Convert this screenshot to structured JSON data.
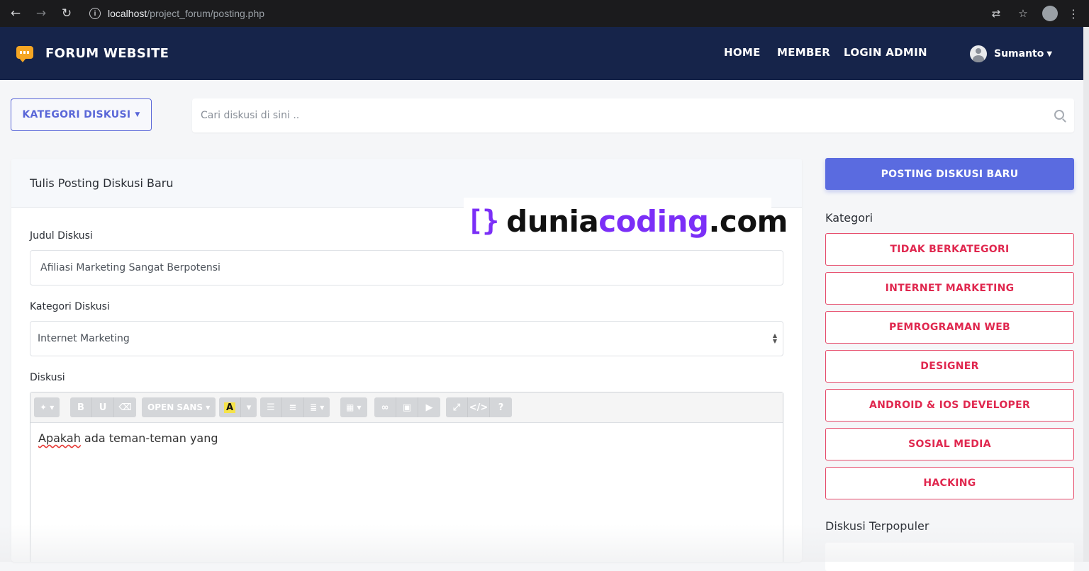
{
  "browser": {
    "url_host": "localhost",
    "url_path": "/project_forum/posting.php",
    "icons": [
      "back-arrow-icon",
      "forward-arrow-icon",
      "reload-icon",
      "info-icon",
      "translate-icon",
      "star-icon",
      "profile-icon",
      "more-icon"
    ]
  },
  "navbar": {
    "brand": "FORUM WEBSITE",
    "menu": [
      "HOME",
      "MEMBER",
      "LOGIN ADMIN"
    ],
    "user": "Sumanto",
    "bg_color": "#16244a"
  },
  "toolbar": {
    "kategori_button": "KATEGORI DISKUSI",
    "search_placeholder": "Cari diskusi di sini .."
  },
  "form": {
    "title": "Tulis Posting Diskusi Baru",
    "judul_label": "Judul Diskusi",
    "judul_value": "Afiliasi Marketing Sangat Berpotensi",
    "kategori_label": "Kategori Diskusi",
    "kategori_value": "Internet Marketing",
    "diskusi_label": "Diskusi",
    "editor_font": "OPEN SANS",
    "editor_text_spell": "Apakah",
    "editor_text_rest": " ada teman-teman yang"
  },
  "sidebar": {
    "post_button": "POSTING DISKUSI BARU",
    "kategori_heading": "Kategori",
    "categories": [
      "TIDAK BERKATEGORI",
      "INTERNET MARKETING",
      "PEMROGRAMAN WEB",
      "DESIGNER",
      "ANDROID & IOS DEVELOPER",
      "SOSIAL MEDIA",
      "HACKING"
    ],
    "popular_heading": "Diskusi Terpopuler"
  },
  "watermark": {
    "bracket": "[}",
    "text_a": "dunia",
    "text_b": "coding",
    "text_c": ".com"
  },
  "colors": {
    "accent": "#5a67d8",
    "category": "#e0284f",
    "watermark": "#7b2ff7"
  }
}
